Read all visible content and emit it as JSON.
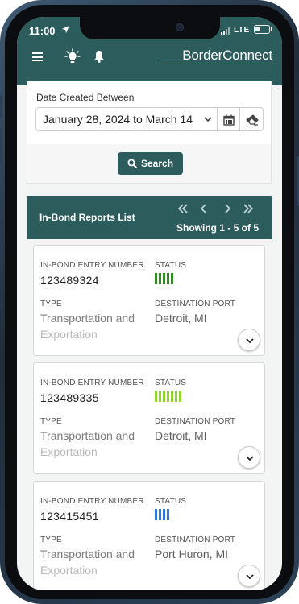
{
  "status_bar": {
    "time": "11:00",
    "network": "LTE"
  },
  "header": {
    "brand": "BorderConnect"
  },
  "filter": {
    "date_label": "Date Created Between",
    "date_value": "January 28, 2024 to March 14",
    "search_label": "Search"
  },
  "list": {
    "title": "In-Bond Reports List",
    "showing": "Showing 1 - 5 of 5",
    "labels": {
      "entry_number": "IN-BOND ENTRY NUMBER",
      "status": "STATUS",
      "type": "TYPE",
      "destination_port": "DESTINATION PORT"
    },
    "items": [
      {
        "entry_number": "123489324",
        "type_line1": "Transportation and",
        "type_line2": "Exportation",
        "destination_port": "Detroit, MI",
        "status_color": "#2e8b1e",
        "status_level": 5
      },
      {
        "entry_number": "123489335",
        "type_line1": "Transportation and",
        "type_line2": "Exportation",
        "destination_port": "Detroit, MI",
        "status_color": "#8fd62a",
        "status_level": 7
      },
      {
        "entry_number": "123415451",
        "type_line1": "Transportation and",
        "type_line2": "Exportation",
        "destination_port": "Port Huron, MI",
        "status_color": "#2a7be4",
        "status_level": 4
      }
    ]
  },
  "colors": {
    "primary": "#2c5c5c"
  }
}
